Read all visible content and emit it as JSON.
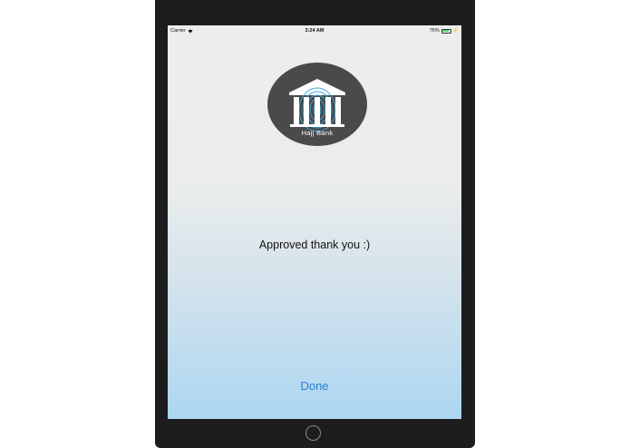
{
  "status_bar": {
    "carrier": "Carrier",
    "time": "3:24 AM",
    "battery_percent": "76%",
    "battery_level": 0.76
  },
  "logo": {
    "text": "Hajj Bank",
    "icon": "bank-fingerprint-icon"
  },
  "message": "Approved thank you :)",
  "done_label": "Done",
  "colors": {
    "accent": "#2d7ed8",
    "logo_bg": "#4a4a4a",
    "fingerprint": "#3aa6e0"
  }
}
